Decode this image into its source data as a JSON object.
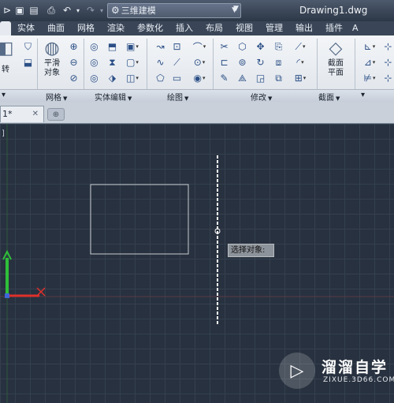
{
  "app": {
    "workspace": "三维建模",
    "document_title": "Drawing1.dwg"
  },
  "tabs": [
    "实体",
    "曲面",
    "网格",
    "渲染",
    "参数化",
    "插入",
    "布局",
    "视图",
    "管理",
    "输出",
    "插件",
    "A"
  ],
  "ribbon": {
    "big_buttons": {
      "rotate_partial": "转",
      "smooth_object": [
        "平滑",
        "对象"
      ],
      "section_plane": [
        "截面",
        "平面"
      ]
    },
    "panels": [
      "网格",
      "实体编辑",
      "绘图",
      "修改",
      "截面"
    ]
  },
  "document_tabs": [
    {
      "label": "1*"
    }
  ],
  "viewport_label": "]",
  "command_tooltip": "选择对象:",
  "watermark": {
    "title": "溜溜自学",
    "url": "ZIXUE.3D66.COM"
  },
  "colors": {
    "canvas": "#28313f",
    "x_axis": "#e0302b",
    "y_axis": "#2fbf3a",
    "rectangle": "#c9cdd2",
    "selected_line": "#ffffff"
  }
}
